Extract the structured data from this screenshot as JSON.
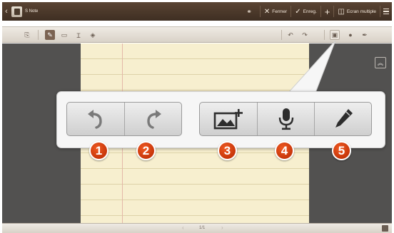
{
  "app": {
    "title": "S Note"
  },
  "actionbar": {
    "close_label": "Fermer",
    "save_label": "Enreg.",
    "multiscreen_label": "Ecran multiple"
  },
  "toolbar": {
    "icons": [
      "new-page-icon",
      "pen-icon",
      "text-box-icon",
      "text-cursor-icon",
      "eraser-icon",
      "undo-icon",
      "redo-icon",
      "insert-image-icon",
      "microphone-icon",
      "pen-settings-icon"
    ]
  },
  "footer": {
    "page_indicator": "1/1"
  },
  "callout": {
    "buttons": [
      {
        "icon": "undo-icon",
        "badge": "1"
      },
      {
        "icon": "redo-icon",
        "badge": "2"
      },
      {
        "icon": "insert-image-icon",
        "badge": "3"
      },
      {
        "icon": "microphone-icon",
        "badge": "4"
      },
      {
        "icon": "pen-icon",
        "badge": "5"
      }
    ]
  },
  "colors": {
    "actionbar": "#4b392b",
    "badge": "#e04a17",
    "paper": "#f7efcf",
    "canvas": "#525150"
  }
}
